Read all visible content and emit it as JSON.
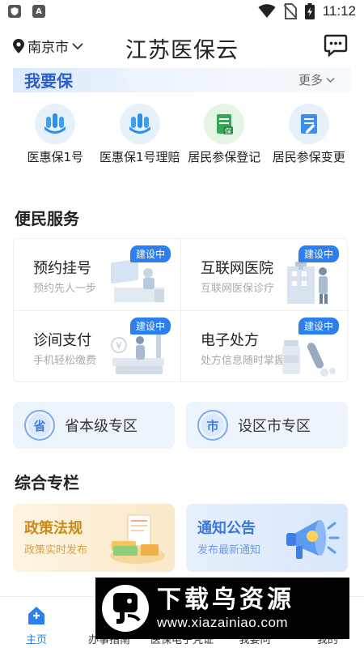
{
  "status_bar": {
    "time": "11:12",
    "left_icons": [
      "shield-icon",
      "a-icon"
    ],
    "right_icons": [
      "wifi-icon",
      "no-sim-icon",
      "battery-charging-icon"
    ]
  },
  "header": {
    "city": "南京市",
    "title": "江苏医保云",
    "location_icon": "location-pin-icon",
    "message_icon": "chat-bubble-icon"
  },
  "insure": {
    "title": "我要保",
    "more_label": "更多",
    "items": [
      {
        "label": "医惠保1号",
        "icon": "hand-leaf-icon"
      },
      {
        "label": "医惠保1号理赔",
        "icon": "hand-leaf-icon"
      },
      {
        "label": "居民参保登记",
        "icon": "document-insure-icon"
      },
      {
        "label": "居民参保变更",
        "icon": "document-edit-icon"
      }
    ]
  },
  "services": {
    "title": "便民服务",
    "items": [
      {
        "name": "预约挂号",
        "sub": "预约先人一步",
        "badge": "建设中"
      },
      {
        "name": "互联网医院",
        "sub": "互联网医保诊疗",
        "badge": "建设中"
      },
      {
        "name": "诊间支付",
        "sub": "手机轻松缴费",
        "badge": "建设中"
      },
      {
        "name": "电子处方",
        "sub": "处方信息随时掌握",
        "badge": "建设中"
      }
    ]
  },
  "zones": [
    {
      "icon_text": "省",
      "label": "省本级专区"
    },
    {
      "icon_text": "市",
      "label": "设区市专区"
    }
  ],
  "columns": {
    "title": "综合专栏",
    "cards": [
      {
        "title": "政策法规",
        "sub": "政策实时发布",
        "title_color": "#c98a1a",
        "sub_color": "#d4a24a"
      },
      {
        "title": "通知公告",
        "sub": "发布最新通知",
        "title_color": "#3c78d8",
        "sub_color": "#6f9be0"
      }
    ]
  },
  "bottom_nav": {
    "items": [
      {
        "label": "主页",
        "icon": "home-icon",
        "active": true
      },
      {
        "label": "办事指南",
        "icon": "guide-icon",
        "active": false
      },
      {
        "label": "医保电子凭证",
        "icon": "qr-card-icon",
        "active": false
      },
      {
        "label": "我要问",
        "icon": "question-icon",
        "active": false
      },
      {
        "label": "我的",
        "icon": "user-icon",
        "active": false
      }
    ]
  },
  "watermark": {
    "name": "下载鸟资源",
    "url": "www.xiazainiao.com"
  },
  "colors": {
    "accent": "#2d7ff0",
    "insure_title": "#2b5fc8"
  }
}
